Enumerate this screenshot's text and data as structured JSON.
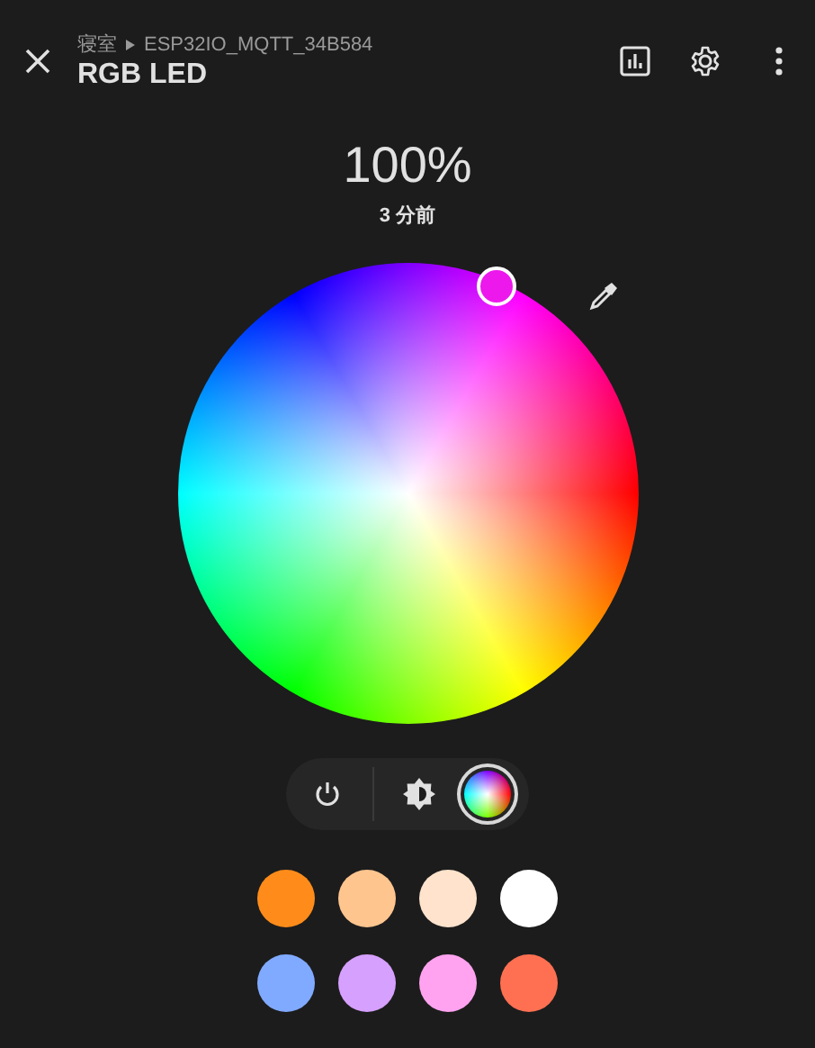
{
  "header": {
    "breadcrumb_area": "寝室",
    "breadcrumb_device": "ESP32IO_MQTT_34B584",
    "title": "RGB LED"
  },
  "state": {
    "brightness": "100%",
    "last_changed": "3 分前"
  },
  "modes": [
    {
      "kind": "power",
      "selected": false
    },
    {
      "kind": "brightness",
      "selected": false
    },
    {
      "kind": "color",
      "selected": true
    }
  ],
  "presets": [
    {
      "color": "#ff8c1a"
    },
    {
      "color": "#ffc58f"
    },
    {
      "color": "#ffe3cc"
    },
    {
      "color": "#ffffff"
    },
    {
      "color": "#80aaff"
    },
    {
      "color": "#d6a0ff"
    },
    {
      "color": "#ffa3f0"
    },
    {
      "color": "#ff7052"
    }
  ]
}
